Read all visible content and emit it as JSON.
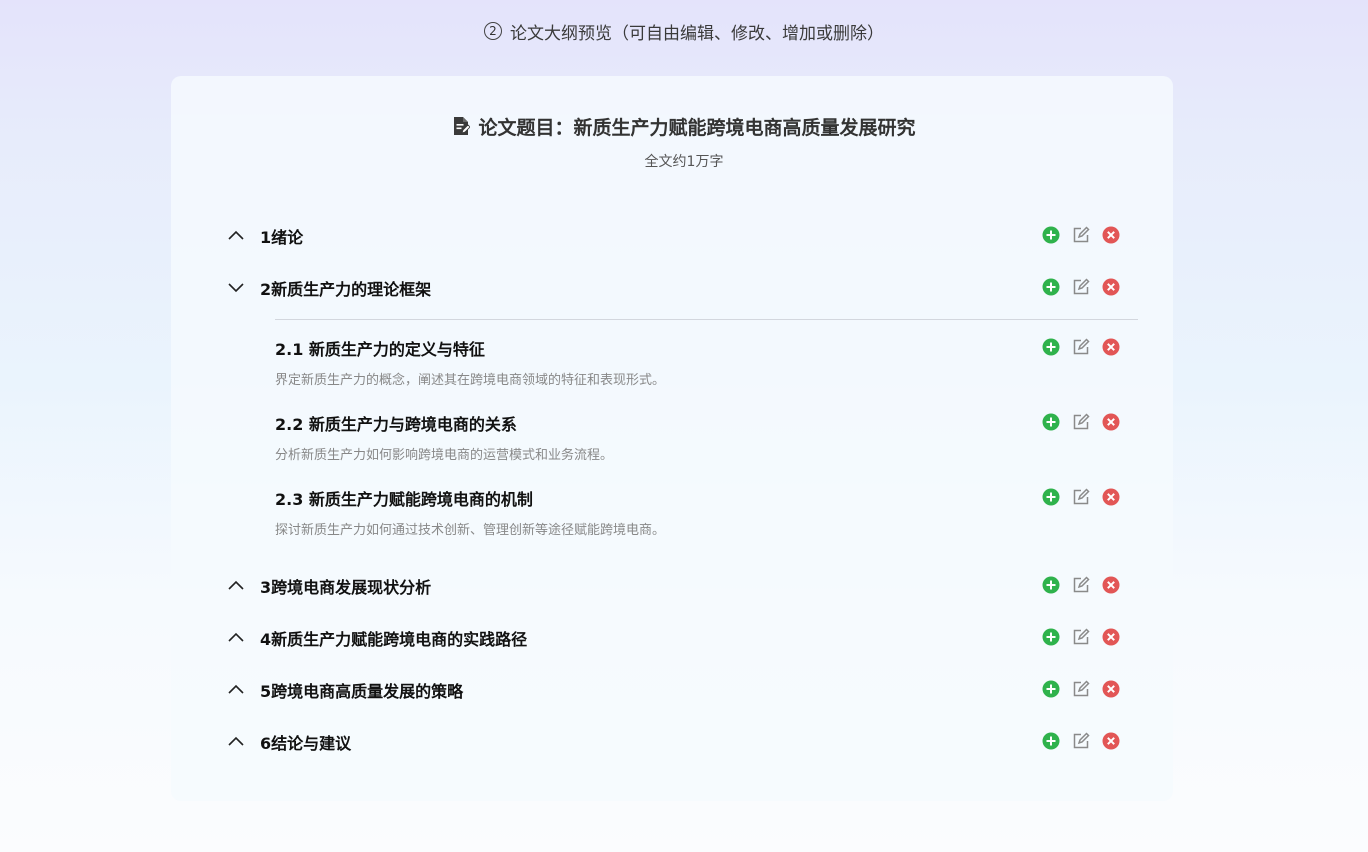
{
  "step": {
    "number": "2",
    "title": "论文大纲预览（可自由编辑、修改、增加或删除）"
  },
  "paper": {
    "title": "论文题目：新质生产力赋能跨境电商高质量发展研究",
    "word_count": "全文约1万字"
  },
  "outline": [
    {
      "title": "1绪论",
      "expanded": false
    },
    {
      "title": "2新质生产力的理论框架",
      "expanded": true,
      "children": [
        {
          "title": "2.1 新质生产力的定义与特征",
          "desc": "界定新质生产力的概念，阐述其在跨境电商领域的特征和表现形式。"
        },
        {
          "title": "2.2 新质生产力与跨境电商的关系",
          "desc": "分析新质生产力如何影响跨境电商的运营模式和业务流程。"
        },
        {
          "title": "2.3 新质生产力赋能跨境电商的机制",
          "desc": "探讨新质生产力如何通过技术创新、管理创新等途径赋能跨境电商。"
        }
      ]
    },
    {
      "title": "3跨境电商发展现状分析",
      "expanded": false
    },
    {
      "title": "4新质生产力赋能跨境电商的实践路径",
      "expanded": false
    },
    {
      "title": "5跨境电商高质量发展的策略",
      "expanded": false
    },
    {
      "title": "6结论与建议",
      "expanded": false
    }
  ],
  "icons": {
    "add": "plus-circle-icon",
    "edit": "edit-icon",
    "delete": "close-circle-icon",
    "doc": "document-edit-icon"
  },
  "colors": {
    "add": "#2fb24c",
    "edit": "#8a8a8a",
    "delete": "#e25656"
  }
}
